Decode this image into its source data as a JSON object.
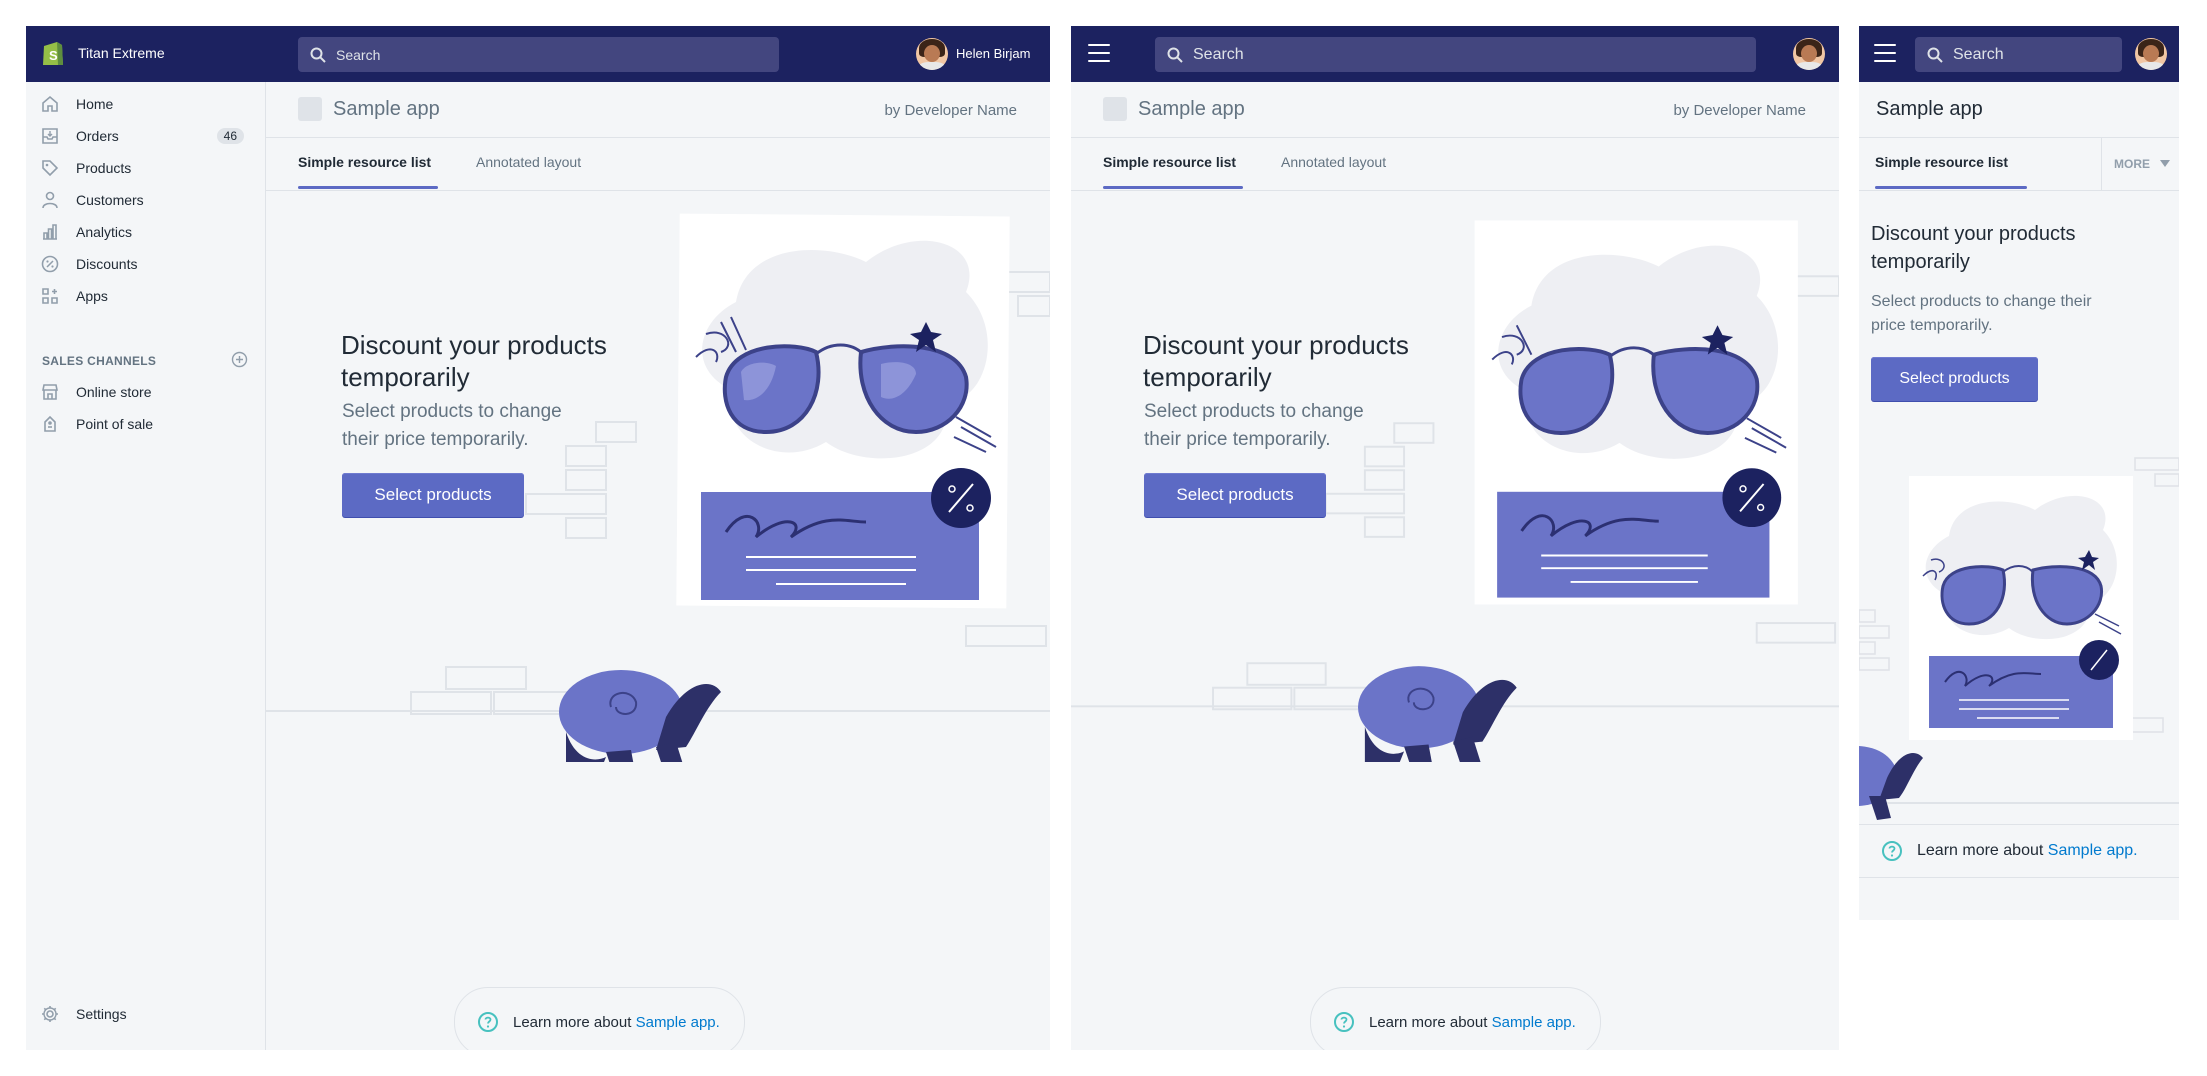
{
  "store": {
    "name": "Titan Extreme"
  },
  "search": {
    "placeholder": "Search"
  },
  "user": {
    "name": "Helen Birjam"
  },
  "sidebar": {
    "items": [
      {
        "label": "Home",
        "icon": "home-icon"
      },
      {
        "label": "Orders",
        "icon": "orders-icon",
        "badge": "46"
      },
      {
        "label": "Products",
        "icon": "tag-icon"
      },
      {
        "label": "Customers",
        "icon": "person-icon"
      },
      {
        "label": "Analytics",
        "icon": "bar-chart-icon"
      },
      {
        "label": "Discounts",
        "icon": "discount-icon"
      },
      {
        "label": "Apps",
        "icon": "apps-icon"
      }
    ],
    "channels_heading": "SALES CHANNELS",
    "channels": [
      {
        "label": "Online store",
        "icon": "store-icon"
      },
      {
        "label": "Point of sale",
        "icon": "pos-icon"
      }
    ],
    "settings_label": "Settings"
  },
  "app": {
    "title": "Sample app",
    "developer": "by Developer Name",
    "tabs": [
      {
        "label": "Simple resource list",
        "active": true
      },
      {
        "label": "Annotated layout",
        "active": false
      }
    ],
    "more_label": "MORE"
  },
  "empty_state": {
    "heading": "Discount your products temporarily",
    "heading_line1": "Discount your products",
    "heading_line2": "temporarily",
    "description_desktop_line1": "Select products to change",
    "description_desktop_line2": "their price temporarily.",
    "description_mobile_line1": "Select products to change their",
    "description_mobile_line2": "price temporarily.",
    "action_label": "Select products"
  },
  "footer": {
    "text": "Learn more about",
    "link": "Sample app."
  },
  "colors": {
    "topbar": "#1c2260",
    "search_bg": "#43467f",
    "accent": "#5c6ac4",
    "link": "#007ace",
    "background": "#f4f6f8",
    "logo_green": "#95bf47"
  }
}
